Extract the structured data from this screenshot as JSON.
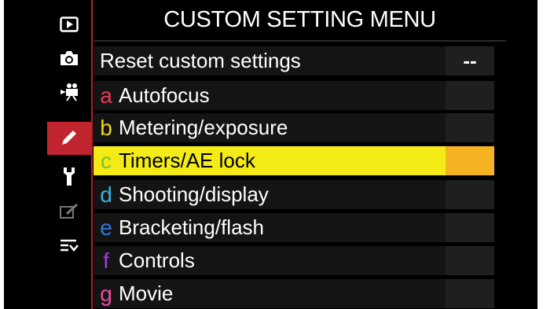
{
  "header": {
    "title": "CUSTOM SETTING MENU"
  },
  "sidebar": {
    "icons": [
      {
        "name": "playback-icon"
      },
      {
        "name": "camera-icon"
      },
      {
        "name": "movie-icon"
      },
      {
        "name": "pencil-icon",
        "active": true
      },
      {
        "name": "wrench-icon"
      },
      {
        "name": "retouch-icon"
      },
      {
        "name": "my-menu-icon"
      }
    ]
  },
  "menu": {
    "reset": {
      "label": "Reset custom settings",
      "value": "--"
    },
    "items": [
      {
        "letter": "a",
        "label": "Autofocus",
        "color": "#e8395f"
      },
      {
        "letter": "b",
        "label": "Metering/exposure",
        "color": "#f0d21a"
      },
      {
        "letter": "c",
        "label": "Timers/AE lock",
        "color": "#7bc230",
        "selected": true
      },
      {
        "letter": "d",
        "label": "Shooting/display",
        "color": "#33b6e0"
      },
      {
        "letter": "e",
        "label": "Bracketing/flash",
        "color": "#2f78e0"
      },
      {
        "letter": "f",
        "label": "Controls",
        "color": "#a23be0"
      },
      {
        "letter": "g",
        "label": "Movie",
        "color": "#e84fa6"
      }
    ]
  },
  "colors": {
    "accent": "#c0252f",
    "selection": "#f4ea16",
    "selection_value": "#f5b223"
  }
}
